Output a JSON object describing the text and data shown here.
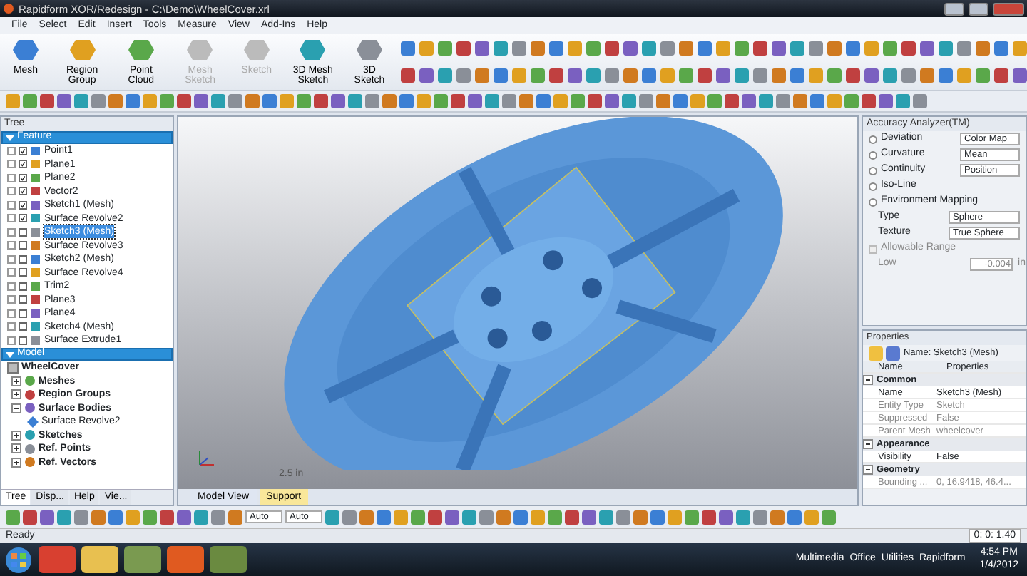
{
  "window": {
    "title": "Rapidform XOR/Redesign - C:\\Demo\\WheelCover.xrl"
  },
  "menu": [
    "File",
    "Select",
    "Edit",
    "Insert",
    "Tools",
    "Measure",
    "View",
    "Add-Ins",
    "Help"
  ],
  "ribbon": {
    "buttons": [
      {
        "label": "Mesh",
        "disabled": false
      },
      {
        "label": "Region Group",
        "disabled": false
      },
      {
        "label": "Point Cloud",
        "disabled": false
      },
      {
        "label": "Mesh Sketch",
        "disabled": true
      },
      {
        "label": "Sketch",
        "disabled": true
      },
      {
        "label": "3D Mesh Sketch",
        "disabled": false
      },
      {
        "label": "3D Sketch",
        "disabled": false
      }
    ]
  },
  "tree_panel": {
    "title": "Tree",
    "feature": {
      "title": "Feature",
      "items": [
        {
          "label": "Point1",
          "checked": true,
          "selected": false
        },
        {
          "label": "Plane1",
          "checked": true,
          "selected": false
        },
        {
          "label": "Plane2",
          "checked": true,
          "selected": false
        },
        {
          "label": "Vector2",
          "checked": true,
          "selected": false
        },
        {
          "label": "Sketch1 (Mesh)",
          "checked": true,
          "selected": false
        },
        {
          "label": "Surface Revolve2",
          "checked": true,
          "selected": false
        },
        {
          "label": "Sketch3 (Mesh)",
          "checked": false,
          "selected": true
        },
        {
          "label": "Surface Revolve3",
          "checked": false,
          "selected": false
        },
        {
          "label": "Sketch2 (Mesh)",
          "checked": false,
          "selected": false
        },
        {
          "label": "Surface Revolve4",
          "checked": false,
          "selected": false
        },
        {
          "label": "Trim2",
          "checked": false,
          "selected": false
        },
        {
          "label": "Plane3",
          "checked": false,
          "selected": false
        },
        {
          "label": "Plane4",
          "checked": false,
          "selected": false
        },
        {
          "label": "Sketch4 (Mesh)",
          "checked": false,
          "selected": false
        },
        {
          "label": "Surface Extrude1",
          "checked": false,
          "selected": false
        }
      ]
    },
    "model": {
      "title": "Model",
      "root": "WheelCover",
      "items": [
        {
          "label": "Meshes",
          "expanded": false
        },
        {
          "label": "Region Groups",
          "expanded": false
        },
        {
          "label": "Surface Bodies",
          "expanded": true,
          "children": [
            {
              "label": "Surface Revolve2"
            }
          ]
        },
        {
          "label": "Sketches",
          "expanded": false
        },
        {
          "label": "Ref. Points",
          "expanded": false
        },
        {
          "label": "Ref. Vectors",
          "expanded": false
        }
      ]
    },
    "tabs": [
      {
        "label": "Tree",
        "selected": true
      },
      {
        "label": "Disp...",
        "selected": false
      },
      {
        "label": "Help",
        "selected": false
      },
      {
        "label": "Vie...",
        "selected": false
      }
    ]
  },
  "viewport": {
    "scale": "2.5 in",
    "tabs": [
      {
        "label": "Model View",
        "selected": false
      },
      {
        "label": "Support",
        "selected": true
      }
    ]
  },
  "accuracy_analyzer": {
    "title": "Accuracy Analyzer(TM)",
    "options": [
      {
        "label": "Deviation",
        "selected": false,
        "value": "Color Map"
      },
      {
        "label": "Curvature",
        "selected": false,
        "value": "Mean"
      },
      {
        "label": "Continuity",
        "selected": false,
        "value": "Position"
      },
      {
        "label": "Iso-Line",
        "selected": false
      },
      {
        "label": "Environment Mapping",
        "selected": false
      }
    ],
    "fields": [
      {
        "label": "Type",
        "value": "Sphere"
      },
      {
        "label": "Texture",
        "value": "True Sphere"
      }
    ],
    "allowable_range": {
      "label": "Allowable Range",
      "checked": false,
      "disabled": true,
      "low_label": "Low",
      "low_value": "-0.004",
      "unit": "in"
    }
  },
  "properties": {
    "title": "Properties",
    "name": "Name: Sketch3 (Mesh)",
    "columns": [
      "Name",
      "Properties"
    ],
    "groups": [
      {
        "title": "Common",
        "expanded": true,
        "rows": [
          {
            "name": "Name",
            "value": "Sketch3 (Mesh)",
            "disabled": false
          },
          {
            "name": "Entity Type",
            "value": "Sketch",
            "disabled": true
          },
          {
            "name": "Suppressed",
            "value": "False",
            "disabled": true
          },
          {
            "name": "Parent Mesh",
            "value": "wheelcover",
            "disabled": true
          }
        ]
      },
      {
        "title": "Appearance",
        "expanded": true,
        "rows": [
          {
            "name": "Visibility",
            "value": "False",
            "disabled": false
          }
        ]
      },
      {
        "title": "Geometry",
        "expanded": true,
        "rows": [
          {
            "name": "Bounding ...",
            "value": "0, 16.9418, 46.4...",
            "disabled": true
          }
        ]
      }
    ]
  },
  "bottom_toolbar": {
    "selects": [
      "Auto",
      "Auto"
    ]
  },
  "status_bar": {
    "text": "Ready",
    "coords": "0: 0: 1.40"
  },
  "taskbar": {
    "groups": [
      "Multimedia",
      "Office",
      "Utilities",
      "Rapidform"
    ],
    "time": "4:54 PM",
    "date": "1/4/2012"
  }
}
